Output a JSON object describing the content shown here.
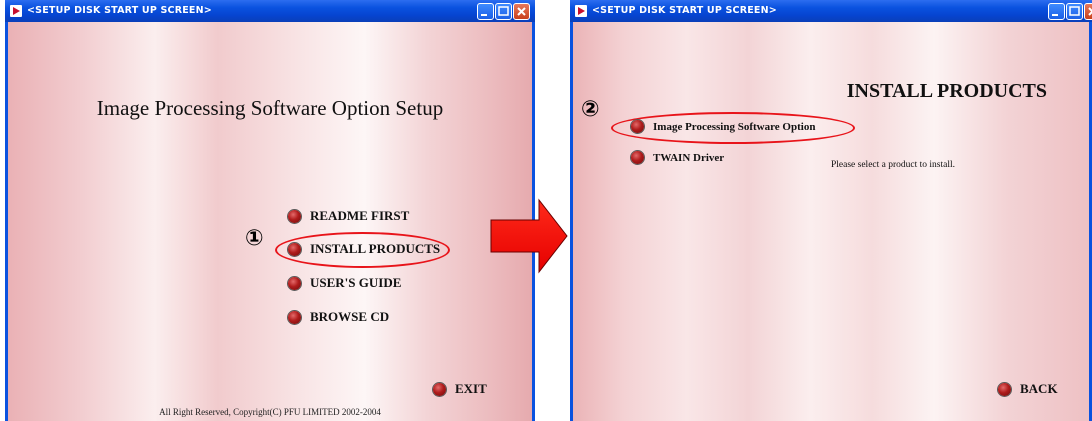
{
  "window1": {
    "title": "<SETUP DISK START UP SCREEN>",
    "heading": "Image Processing Software Option Setup",
    "menu": {
      "readme": "README FIRST",
      "install": "INSTALL PRODUCTS",
      "guide": "USER'S GUIDE",
      "browse": "BROWSE CD"
    },
    "exit_label": "EXIT",
    "footer": "All Right Reserved, Copyright(C) PFU LIMITED 2002-2004",
    "step_marker": "①"
  },
  "window2": {
    "title": "<SETUP DISK START UP SCREEN>",
    "heading": "INSTALL PRODUCTS",
    "items": {
      "image_processing": "Image Processing Software Option",
      "twain": "TWAIN Driver"
    },
    "prompt": "Please select a product to install.",
    "back_label": "BACK",
    "step_marker": "②"
  },
  "colors": {
    "titlebar": "#0a52df",
    "highlight": "#e8141a",
    "arrow": "#ff0000",
    "bullet": "#b01c1c"
  },
  "icons": [
    "app-icon",
    "minimize-icon",
    "maximize-icon",
    "close-icon",
    "bullet-icon",
    "right-arrow-icon"
  ]
}
